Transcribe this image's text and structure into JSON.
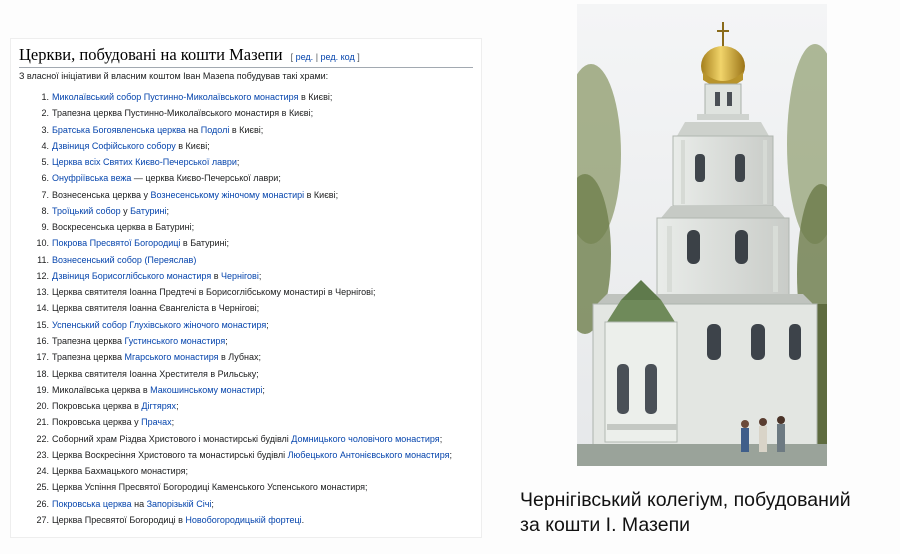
{
  "article": {
    "heading": "Церкви, побудовані на кошти Мазепи",
    "edit_open": "[ ",
    "edit_label": "ред.",
    "edit_sep": " | ",
    "edit_code_label": "ред. код",
    "edit_close": " ]",
    "intro": "З власної ініціативи й власним коштом Іван Мазепа побудував такі храми:",
    "items": [
      {
        "num": "1.",
        "parts": [
          {
            "t": "Миколаївський собор Пустинно-Миколаївського монастиря",
            "link": true
          },
          {
            "t": " в Києві;",
            "link": false
          }
        ]
      },
      {
        "num": "2.",
        "parts": [
          {
            "t": "Трапезна церква Пустинно-Миколаївського монастиря в Києві;",
            "link": false
          }
        ]
      },
      {
        "num": "3.",
        "parts": [
          {
            "t": "Братська Богоявленська церква",
            "link": true
          },
          {
            "t": " на ",
            "link": false
          },
          {
            "t": "Подолі",
            "link": true
          },
          {
            "t": " в Києві;",
            "link": false
          }
        ]
      },
      {
        "num": "4.",
        "parts": [
          {
            "t": "Дзвіниця Софійського собору",
            "link": true
          },
          {
            "t": " в Києві;",
            "link": false
          }
        ]
      },
      {
        "num": "5.",
        "parts": [
          {
            "t": "Церква всіх Святих Києво-Печерської лаври",
            "link": true
          },
          {
            "t": ";",
            "link": false
          }
        ]
      },
      {
        "num": "6.",
        "parts": [
          {
            "t": "Онуфріївська вежа",
            "link": true
          },
          {
            "t": " — церква Києво-Печерської лаври;",
            "link": false
          }
        ]
      },
      {
        "num": "7.",
        "parts": [
          {
            "t": "Вознесенська церква у ",
            "link": false
          },
          {
            "t": "Вознесенському жіночому монастирі",
            "link": true
          },
          {
            "t": " в Києві;",
            "link": false
          }
        ]
      },
      {
        "num": "8.",
        "parts": [
          {
            "t": "Троїцький собор",
            "link": true
          },
          {
            "t": " у ",
            "link": false
          },
          {
            "t": "Батурині",
            "link": true
          },
          {
            "t": ";",
            "link": false
          }
        ]
      },
      {
        "num": "9.",
        "parts": [
          {
            "t": "Воскресенська церква в Батурині;",
            "link": false
          }
        ]
      },
      {
        "num": "10.",
        "parts": [
          {
            "t": "Покрова Пресвятої Богородиці",
            "link": true
          },
          {
            "t": " в Батурині;",
            "link": false
          }
        ]
      },
      {
        "num": "11.",
        "parts": [
          {
            "t": "Вознесенський собор (Переяслав)",
            "link": true
          }
        ]
      },
      {
        "num": "12.",
        "parts": [
          {
            "t": "Дзвіниця Борисоглібського монастиря",
            "link": true
          },
          {
            "t": " в ",
            "link": false
          },
          {
            "t": "Чернігові",
            "link": true
          },
          {
            "t": ";",
            "link": false
          }
        ]
      },
      {
        "num": "13.",
        "parts": [
          {
            "t": "Церква святителя Іоанна Предтечі в Борисоглібському монастирі в Чернігові;",
            "link": false
          }
        ]
      },
      {
        "num": "14.",
        "parts": [
          {
            "t": "Церква святителя Іоанна Євангеліста в Чернігові;",
            "link": false
          }
        ]
      },
      {
        "num": "15.",
        "parts": [
          {
            "t": "Успенський собор Глухівського жіночого монастиря",
            "link": true
          },
          {
            "t": ";",
            "link": false
          }
        ]
      },
      {
        "num": "16.",
        "parts": [
          {
            "t": "Трапезна церква ",
            "link": false
          },
          {
            "t": "Густинського монастиря",
            "link": true
          },
          {
            "t": ";",
            "link": false
          }
        ]
      },
      {
        "num": "17.",
        "parts": [
          {
            "t": "Трапезна церква ",
            "link": false
          },
          {
            "t": "Мгарського монастиря",
            "link": true
          },
          {
            "t": " в Лубнах;",
            "link": false
          }
        ]
      },
      {
        "num": "18.",
        "parts": [
          {
            "t": "Церква святителя Іоанна Хрестителя в Рильську;",
            "link": false
          }
        ]
      },
      {
        "num": "19.",
        "parts": [
          {
            "t": "Миколаївська церква в ",
            "link": false
          },
          {
            "t": "Макошинському монастирі",
            "link": true
          },
          {
            "t": ";",
            "link": false
          }
        ]
      },
      {
        "num": "20.",
        "parts": [
          {
            "t": "Покровська церква в ",
            "link": false
          },
          {
            "t": "Дігтярях",
            "link": true
          },
          {
            "t": ";",
            "link": false
          }
        ]
      },
      {
        "num": "21.",
        "parts": [
          {
            "t": "Покровська церква у ",
            "link": false
          },
          {
            "t": "Прачах",
            "link": true
          },
          {
            "t": ";",
            "link": false
          }
        ]
      },
      {
        "num": "22.",
        "parts": [
          {
            "t": "Соборний храм Різдва Христового і монастирські будівлі ",
            "link": false
          },
          {
            "t": "Домницького чоловічого монастиря",
            "link": true
          },
          {
            "t": ";",
            "link": false
          }
        ]
      },
      {
        "num": "23.",
        "parts": [
          {
            "t": "Церква Воскресіння Христового та монастирські будівлі ",
            "link": false
          },
          {
            "t": "Любецького Антонієвського монастиря",
            "link": true
          },
          {
            "t": ";",
            "link": false
          }
        ]
      },
      {
        "num": "24.",
        "parts": [
          {
            "t": "Церква Бахмацького монастиря;",
            "link": false
          }
        ]
      },
      {
        "num": "25.",
        "parts": [
          {
            "t": "Церква Успіння Пресвятої Богородиці Каменського Успенського монастиря;",
            "link": false
          }
        ]
      },
      {
        "num": "26.",
        "parts": [
          {
            "t": "Покровська церква",
            "link": true
          },
          {
            "t": " на ",
            "link": false
          },
          {
            "t": "Запорізькій Січі",
            "link": true
          },
          {
            "t": ";",
            "link": false
          }
        ]
      },
      {
        "num": "27.",
        "parts": [
          {
            "t": "Церква Пресвятої Богородиці в ",
            "link": false
          },
          {
            "t": "Новобогородицькій фортеці",
            "link": true
          },
          {
            "t": ".",
            "link": false
          }
        ]
      }
    ]
  },
  "caption": {
    "line1": "Чернігівський колегіум, побудований",
    "line2": "за кошти І. Мазепи"
  },
  "colors": {
    "link": "#0645ad",
    "text": "#202122",
    "dome_gold": "#d8b23a"
  }
}
